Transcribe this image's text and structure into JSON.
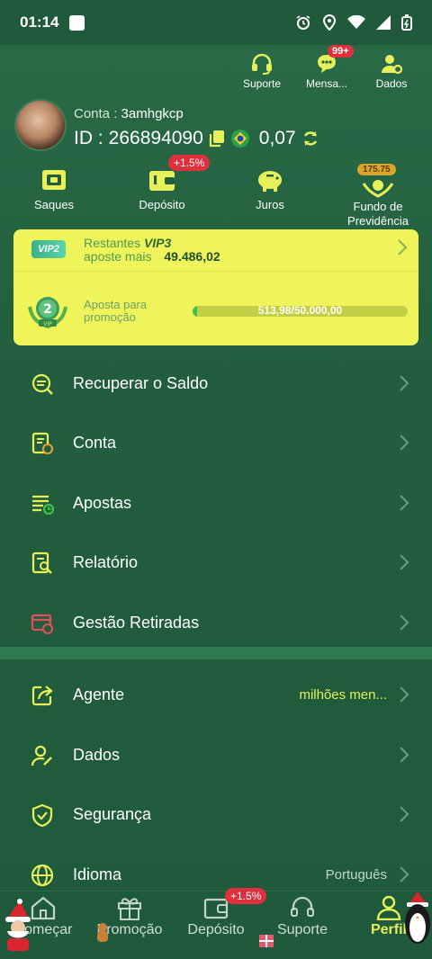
{
  "status_bar": {
    "time": "01:14"
  },
  "header_actions": [
    {
      "label": "Suporte",
      "icon": "headset-icon"
    },
    {
      "label": "Mensa...",
      "icon": "message-icon",
      "badge": "99+"
    },
    {
      "label": "Dados",
      "icon": "user-gear-icon"
    }
  ],
  "profile": {
    "account_label": "Conta :",
    "account_name": "3amhgkcp",
    "id_label": "ID :",
    "id_value": "266894090",
    "balance": "0,07"
  },
  "quick_actions": [
    {
      "label": "Saques",
      "icon": "cash-icon"
    },
    {
      "label": "Depósito",
      "icon": "wallet-icon",
      "badge": "+1.5%"
    },
    {
      "label": "Juros",
      "icon": "piggy-bank-icon"
    },
    {
      "label": "Fundo de Previdência",
      "icon": "hands-coin-icon",
      "badge": "175.75"
    }
  ],
  "vip": {
    "tag": "VIP2",
    "remaining_label": "Restantes",
    "next_level": "VIP3",
    "bet_more_label": "aposte mais",
    "bet_more_value": "49.486,02",
    "medal_level": "2",
    "medal_text": "VIP",
    "promo_label_1": "Aposta para",
    "promo_label_2": "promoção",
    "progress_text": "513,98/50.000,00",
    "progress_fraction": 0.0103
  },
  "menu_primary": [
    {
      "label": "Recuperar o Saldo",
      "icon": "recover-balance-icon"
    },
    {
      "label": "Conta",
      "icon": "account-doc-icon"
    },
    {
      "label": "Apostas",
      "icon": "bets-list-icon"
    },
    {
      "label": "Relatório",
      "icon": "report-search-icon"
    },
    {
      "label": "Gestão Retiradas",
      "icon": "withdraw-manage-icon"
    }
  ],
  "menu_secondary": [
    {
      "label": "Agente",
      "icon": "share-icon",
      "value": "milhões men..."
    },
    {
      "label": "Dados",
      "icon": "user-edit-icon",
      "value": ""
    },
    {
      "label": "Segurança",
      "icon": "shield-check-icon",
      "value": ""
    },
    {
      "label": "Idioma",
      "icon": "globe-icon",
      "value": "Português"
    }
  ],
  "bottom_nav": [
    {
      "label": "Começar",
      "icon": "home-icon",
      "active": false
    },
    {
      "label": "Promoção",
      "icon": "gift-icon",
      "active": false
    },
    {
      "label": "Depósito",
      "icon": "wallet-icon",
      "active": false,
      "badge": "+1.5%"
    },
    {
      "label": "Suporte",
      "icon": "headset-icon",
      "active": false
    },
    {
      "label": "Perfil",
      "icon": "person-icon",
      "active": true
    }
  ],
  "colors": {
    "background": "#225e3e",
    "accent_yellow": "#eef45a",
    "highlight_text": "#e6f05a",
    "badge_red": "#e0303e",
    "icon_yellow": "#e6f05a"
  }
}
